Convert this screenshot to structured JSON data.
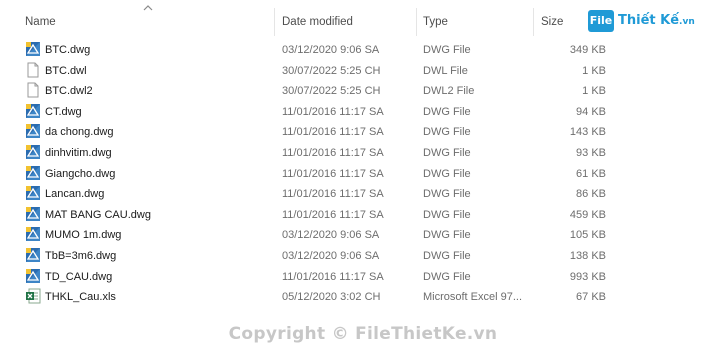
{
  "columns": {
    "name": "Name",
    "date_modified": "Date modified",
    "type": "Type",
    "size": "Size"
  },
  "logo": {
    "mark": "File",
    "text": "Thiết Kế",
    "suffix": ".vn"
  },
  "files": [
    {
      "name": "BTC.dwg",
      "date": "03/12/2020 9:06 SA",
      "type": "DWG File",
      "size": "349 KB",
      "icon": "dwg-file-icon"
    },
    {
      "name": "BTC.dwl",
      "date": "30/07/2022 5:25 CH",
      "type": "DWL File",
      "size": "1 KB",
      "icon": "blank-file-icon"
    },
    {
      "name": "BTC.dwl2",
      "date": "30/07/2022 5:25 CH",
      "type": "DWL2 File",
      "size": "1 KB",
      "icon": "blank-file-icon"
    },
    {
      "name": "CT.dwg",
      "date": "11/01/2016 11:17 SA",
      "type": "DWG File",
      "size": "94 KB",
      "icon": "dwg-file-icon"
    },
    {
      "name": "da chong.dwg",
      "date": "11/01/2016 11:17 SA",
      "type": "DWG File",
      "size": "143 KB",
      "icon": "dwg-file-icon"
    },
    {
      "name": "dinhvitim.dwg",
      "date": "11/01/2016 11:17 SA",
      "type": "DWG File",
      "size": "93 KB",
      "icon": "dwg-file-icon"
    },
    {
      "name": "Giangcho.dwg",
      "date": "11/01/2016 11:17 SA",
      "type": "DWG File",
      "size": "61 KB",
      "icon": "dwg-file-icon"
    },
    {
      "name": "Lancan.dwg",
      "date": "11/01/2016 11:17 SA",
      "type": "DWG File",
      "size": "86 KB",
      "icon": "dwg-file-icon"
    },
    {
      "name": "MAT BANG CAU.dwg",
      "date": "11/01/2016 11:17 SA",
      "type": "DWG File",
      "size": "459 KB",
      "icon": "dwg-file-icon"
    },
    {
      "name": "MUMO 1m.dwg",
      "date": "03/12/2020 9:06 SA",
      "type": "DWG File",
      "size": "105 KB",
      "icon": "dwg-file-icon"
    },
    {
      "name": "TbB=3m6.dwg",
      "date": "03/12/2020 9:06 SA",
      "type": "DWG File",
      "size": "138 KB",
      "icon": "dwg-file-icon"
    },
    {
      "name": "TD_CAU.dwg",
      "date": "11/01/2016 11:17 SA",
      "type": "DWG File",
      "size": "993 KB",
      "icon": "dwg-file-icon"
    },
    {
      "name": "THKL_Cau.xls",
      "date": "05/12/2020 3:02 CH",
      "type": "Microsoft Excel 97...",
      "size": "67 KB",
      "icon": "excel-file-icon"
    }
  ],
  "watermark": "Copyright © FileThietKe.vn",
  "colors": {
    "dwg_blue": "#2b6cb0",
    "dwg_yellow": "#f2c230",
    "logo_blue": "#1f9ad6",
    "excel_green": "#217346"
  }
}
